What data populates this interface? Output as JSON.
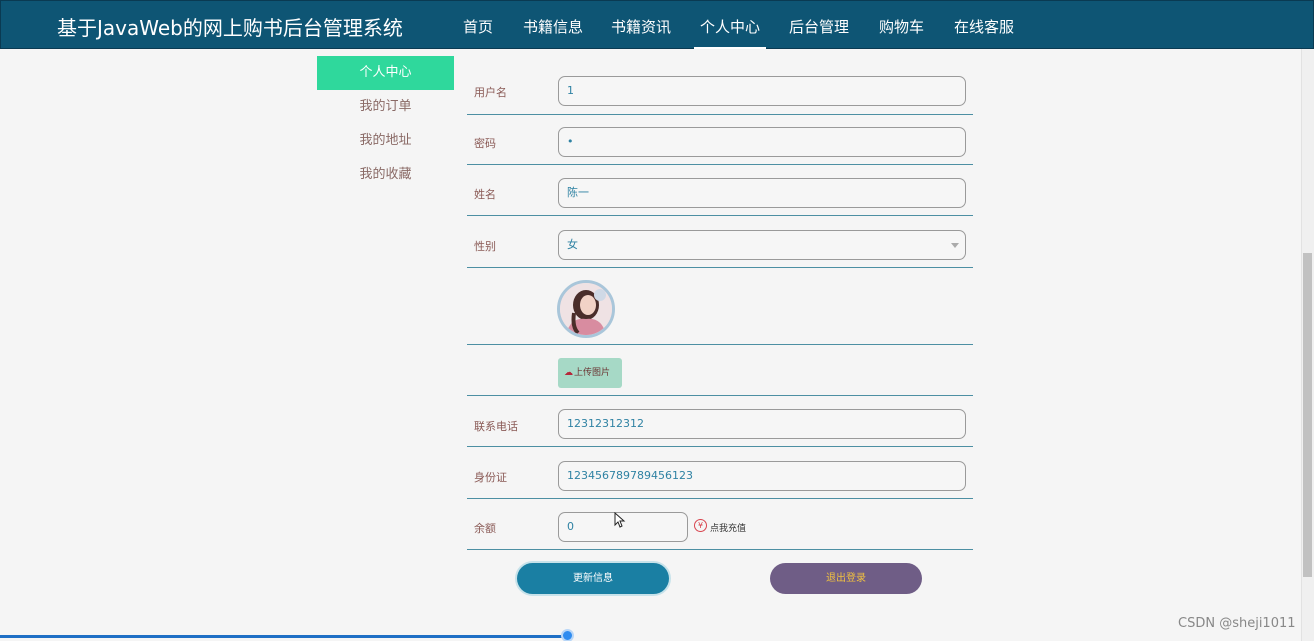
{
  "header": {
    "title": "基于JavaWeb的网上购书后台管理系统",
    "nav": [
      {
        "label": "首页"
      },
      {
        "label": "书籍信息"
      },
      {
        "label": "书籍资讯"
      },
      {
        "label": "个人中心",
        "active": true
      },
      {
        "label": "后台管理"
      },
      {
        "label": "购物车"
      },
      {
        "label": "在线客服"
      }
    ]
  },
  "sidebar": {
    "items": [
      {
        "label": "个人中心",
        "active": true
      },
      {
        "label": "我的订单"
      },
      {
        "label": "我的地址"
      },
      {
        "label": "我的收藏"
      }
    ]
  },
  "form": {
    "username": {
      "label": "用户名",
      "value": "1"
    },
    "password": {
      "label": "密码",
      "value": "•"
    },
    "name": {
      "label": "姓名",
      "value": "陈一"
    },
    "gender": {
      "label": "性别",
      "value": "女"
    },
    "avatar_icon": "user-avatar-photo",
    "upload_label": "上传图片",
    "upload_icon": "cloud-upload-icon",
    "phone": {
      "label": "联系电话",
      "value": "12312312312"
    },
    "id_card": {
      "label": "身份证",
      "value": "123456789789456123"
    },
    "balance": {
      "label": "余额",
      "value": "0"
    },
    "recharge_symbol": "¥",
    "recharge_label": "点我充值"
  },
  "actions": {
    "update_label": "更新信息",
    "logout_label": "退出登录"
  },
  "colors": {
    "header_bg": "#0e5574",
    "sidebar_active": "#2fd89c",
    "update_button": "#1a7fa3",
    "logout_button": "#6f5d86",
    "logout_text": "#f0c040"
  },
  "watermark": "CSDN @sheji1011"
}
